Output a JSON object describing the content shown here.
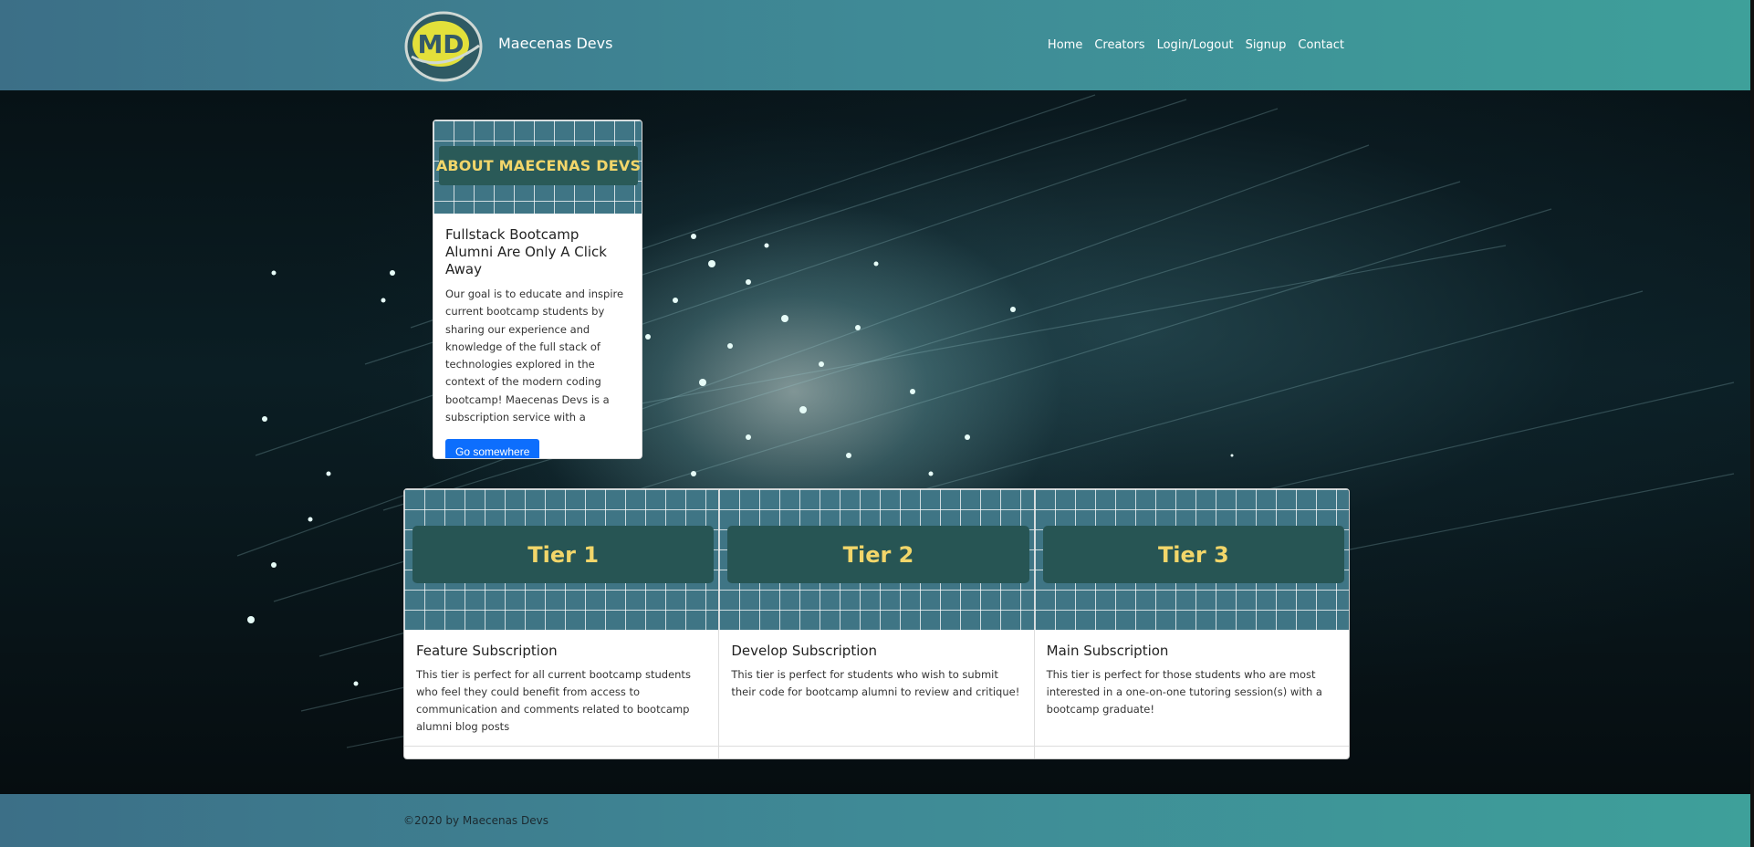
{
  "navbar": {
    "logo_text": "MD",
    "brand": "Maecenas Devs",
    "links": [
      "Home",
      "Creators",
      "Login/Logout",
      "Signup",
      "Contact"
    ]
  },
  "about": {
    "banner": "ABOUT MAECENAS DEVS",
    "title": "Fullstack Bootcamp Alumni Are Only A Click Away",
    "text": "Our goal is to educate and inspire current bootcamp students by sharing our experience and knowledge of the full stack of technologies explored in the context of the modern coding bootcamp! Maecenas Devs is a subscription service with a",
    "button": "Go somewhere"
  },
  "tiers": [
    {
      "banner": "Tier 1",
      "title": "Feature Subscription",
      "text": "This tier is perfect for all current bootcamp students who feel they could benefit from access to communication and comments related to bootcamp alumni blog posts"
    },
    {
      "banner": "Tier 2",
      "title": "Develop Subscription",
      "text": "This tier is perfect for students who wish to submit their code for bootcamp alumni to review and critique!"
    },
    {
      "banner": "Tier 3",
      "title": "Main Subscription",
      "text": "This tier is perfect for those students who are most interested in a one-on-one tutoring session(s) with a bootcamp graduate!"
    }
  ],
  "footer": {
    "text": "©2020 by Maecenas Devs"
  },
  "colors": {
    "navbar_start": "#3c6f87",
    "navbar_end": "#3ea09a",
    "banner_label": "#275554",
    "banner_text": "#f2d66a",
    "button": "#0d6efd"
  }
}
